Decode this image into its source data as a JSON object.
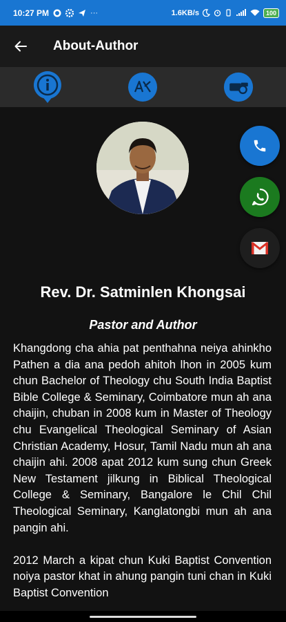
{
  "status": {
    "time": "10:27 PM",
    "net_speed": "1.6KB/s",
    "battery": "100",
    "icons": [
      "whatsapp-icon",
      "settings-icon",
      "telegram-icon",
      "more-icon",
      "moon-icon",
      "alarm-icon",
      "vibrate-icon",
      "signal-icon",
      "wifi-icon",
      "battery-icon"
    ]
  },
  "appbar": {
    "title": "About-Author"
  },
  "tabs": [
    "info-icon",
    "translate-icon",
    "donate-icon"
  ],
  "profile": {
    "name": "Rev. Dr. Satminlen Khongsai",
    "role": "Pastor and Author"
  },
  "contacts": [
    "phone-icon",
    "whatsapp-icon",
    "gmail-icon"
  ],
  "bio": [
    "Khangdong cha ahia pat penthahna neiya ahinkho Pathen a dia ana pedoh ahitoh lhon in 2005 kum chun Bachelor of Theology chu South India Baptist Bible College & Seminary, Coimbatore mun ah ana chaijin, chuban in 2008 kum in  Master of Theology chu Evangelical Theological Seminary of Asian Christian Academy, Hosur, Tamil Nadu mun ah ana chaijin ahi. 2008 apat 2012 kum sung chun Greek New Testament jilkung in Biblical Theological College & Seminary, Bangalore le Chil Chil Theological Seminary, Kanglatongbi mun ah ana pangin ahi.",
    "2012 March a kipat chun Kuki Baptist Convention noiya pastor khat in ahung pangin tuni chan in Kuki Baptist Convention"
  ],
  "colors": {
    "accent": "#1976d2",
    "whatsapp": "#1b7a1f",
    "gmail": "#d93025"
  }
}
